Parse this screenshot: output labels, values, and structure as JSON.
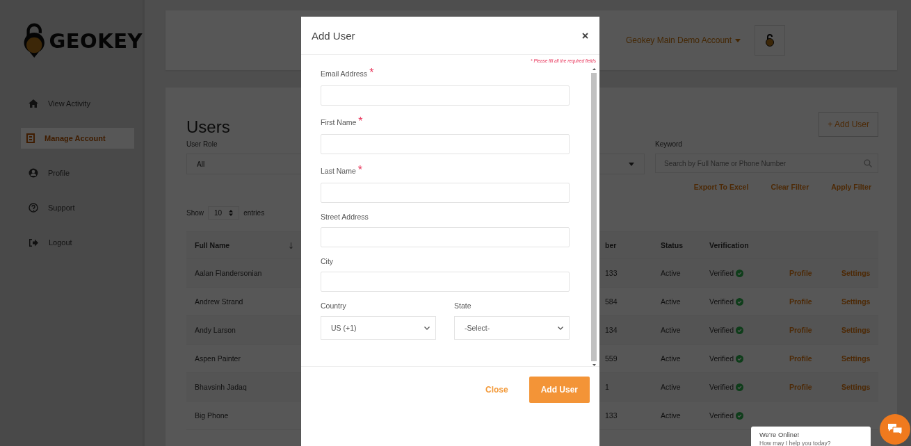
{
  "sidebar": {
    "logo_text": "GEOKEY",
    "items": [
      {
        "label": "View Activity",
        "selected": false
      },
      {
        "label": "Manage Account",
        "selected": true
      },
      {
        "label": "Profile",
        "selected": false
      },
      {
        "label": "Support",
        "selected": false
      },
      {
        "label": "Logout",
        "selected": false
      }
    ]
  },
  "header": {
    "account": "Geokey Main Demo Account"
  },
  "users_page": {
    "title": "Users",
    "add_button": "+ Add User",
    "user_role": {
      "label": "User Role",
      "value": "All"
    },
    "keyword": {
      "label": "Keyword",
      "placeholder": "Search by Full Name or Phone Number"
    },
    "actions": [
      "Export To Excel",
      "Clear Filter",
      "Apply Filter"
    ],
    "length_menu": {
      "before": "Show",
      "value": "10",
      "after": "entries"
    },
    "table": {
      "columns": [
        "Full Name",
        "ber",
        "Status",
        "Verification"
      ],
      "rows": [
        {
          "full_name": "Aalan Flandersonian",
          "column_2": "133",
          "status": "Active",
          "verification": "Verified",
          "verified": true,
          "links": [
            "Profile",
            "Settings"
          ]
        },
        {
          "full_name": "Andrew Strand",
          "column_2": "584",
          "status": "Active",
          "verification": "Verified",
          "verified": true,
          "links": [
            "Profile",
            "Settings"
          ]
        },
        {
          "full_name": "Andy Larson",
          "column_2": "134",
          "status": "Active",
          "verification": "Verified",
          "verified": true,
          "links": [
            "Profile",
            "Settings"
          ]
        },
        {
          "full_name": "Aspen Painter",
          "column_2": "559",
          "status": "Active",
          "verification": "Verified",
          "verified": true,
          "links": [
            "Profile",
            "Settings"
          ]
        },
        {
          "full_name": "Bhavsinh Jadaq",
          "column_2": "1",
          "status": "Active",
          "verification": "Verified",
          "verified": true,
          "links": [
            "Profile",
            "Settings"
          ]
        },
        {
          "full_name": "Big Phone",
          "column_2": "133",
          "status": "Active",
          "verification": "Verified",
          "verified": true,
          "links": []
        }
      ]
    }
  },
  "modal": {
    "title": "Add User",
    "required_note": "* Please fill all the required fields",
    "fields": [
      {
        "label": "Email Address",
        "required_mark": "*",
        "kind": "text"
      },
      {
        "label": "First Name",
        "required_mark": "*",
        "kind": "text"
      },
      {
        "label": "Last Name",
        "required_mark": "*",
        "kind": "text"
      },
      {
        "label": "Street Address",
        "kind": "text"
      },
      {
        "label": "City",
        "kind": "text"
      },
      {
        "label": "Country",
        "kind": "select",
        "value": "US (+1)"
      },
      {
        "label": "State",
        "kind": "select",
        "value": "-Select-"
      }
    ],
    "buttons": [
      {
        "label": "Close",
        "kind": "link"
      },
      {
        "label": "Add User",
        "kind": "primary"
      }
    ]
  },
  "chat": {
    "title": "We're Online!",
    "subtitle": "How may I help you today?"
  }
}
